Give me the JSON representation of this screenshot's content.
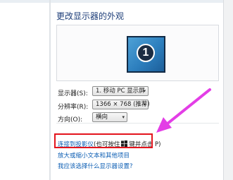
{
  "header": {
    "title": "更改显示器的外观"
  },
  "preview": {
    "monitor_number": "1"
  },
  "settings": {
    "display_label": "显示器(S):",
    "display_value": "1. 移动 PC 显示屏",
    "resolution_label": "分辨率(R):",
    "resolution_value": "1366 × 768 (推荐)",
    "orientation_label": "方向(O):",
    "orientation_value": "横向"
  },
  "links": {
    "projector_part1": "连接到投影仪",
    "projector_part2": "(也可按住",
    "projector_part3": "键并点击 P)",
    "text_size": "放大或缩小文本和其他项目",
    "which_settings": "我应该选择什么显示器设置?"
  },
  "colors": {
    "heading": "#1e3e79",
    "link": "#0b5db3",
    "highlight_border": "#e3141d",
    "arrow": "#e33ee6"
  },
  "icons": {
    "dropdown": "▾"
  }
}
